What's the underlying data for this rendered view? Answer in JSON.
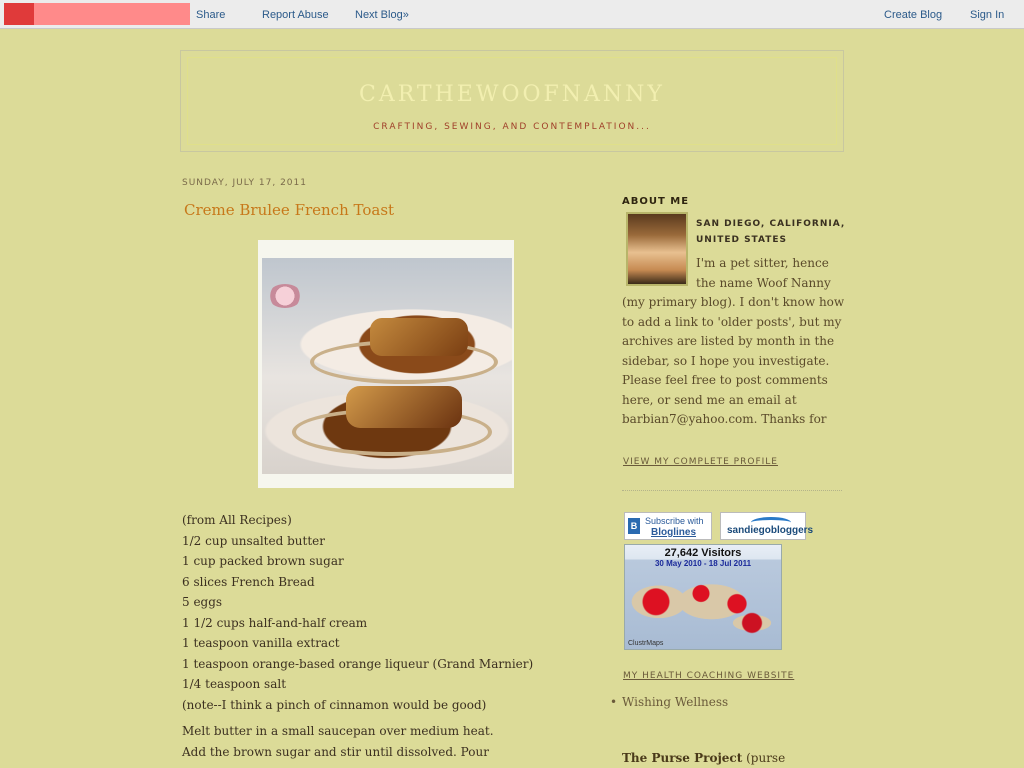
{
  "navbar": {
    "links": [
      "Share",
      "Report Abuse",
      "Next Blog»"
    ],
    "right_links": [
      "Create Blog",
      "Sign In"
    ]
  },
  "header": {
    "title": "CARTHEWOOFNANNY",
    "description": "CRAFTING, SEWING, AND CONTEMPLATION..."
  },
  "post": {
    "date": "SUNDAY, JULY 17, 2011",
    "title": "Creme Brulee French Toast",
    "recipe_lines": [
      "(from All Recipes)",
      "1/2 cup unsalted butter",
      "1 cup packed brown sugar",
      "6 slices French Bread",
      "5 eggs",
      "1 1/2 cups half-and-half cream",
      "1 teaspoon vanilla extract",
      "1 teaspoon orange-based orange liqueur (Grand Marnier)",
      "1/4 teaspoon salt",
      "(note--I think a pinch of cinnamon would be good)",
      "",
      "Melt butter in a small saucepan over medium heat.",
      "Add the brown sugar and stir until dissolved. Pour"
    ]
  },
  "sidebar": {
    "profile_heading": "ABOUT ME",
    "location": "SAN DIEGO, CALIFORNIA, UNITED STATES",
    "bio_lines": [
      "I'm a pet sitter, hence",
      "the name Woof Nanny",
      "(my primary blog). I don't know how",
      "to add a link to 'older posts', but my",
      "archives are listed by month in the",
      "sidebar, so I hope you investigate.",
      "Please feel free to post comments",
      "here, or send me an email at",
      "barbian7@yahoo.com. Thanks for"
    ],
    "profile_link": "VIEW MY COMPLETE PROFILE",
    "bloglines_top": "Subscribe with",
    "bloglines_bottom": "Bloglines",
    "sd_bloggers": "sandiegobloggers",
    "clustrmap_count": "27,642 Visitors",
    "clustrmap_range": "30 May 2010 - 18 Jul 2011",
    "clustrmap_logo": "ClustrMaps",
    "health_link": "MY HEALTH COACHING WEBSITE",
    "list_items": [
      "Wishing Wellness"
    ],
    "purse_line_bold": "The Purse Project",
    "purse_line_rest": " (purse"
  }
}
